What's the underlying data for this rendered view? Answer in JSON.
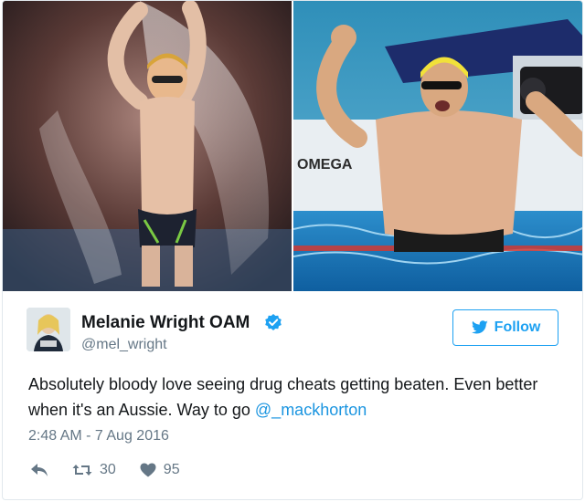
{
  "images": {
    "left": {
      "description_icon": "swimmer-underwater-photo"
    },
    "right": {
      "description_icon": "swimmer-celebrating-photo",
      "signage": "OMEGA"
    }
  },
  "user": {
    "name": "Melanie Wright OAM",
    "handle": "@mel_wright",
    "verified_icon": "verified-badge-icon",
    "avatar_icon": "avatar"
  },
  "follow_button": {
    "label": "Follow",
    "icon": "twitter-bird-icon"
  },
  "tweet": {
    "text": "Absolutely bloody love seeing drug cheats getting beaten. Even better when it's an Aussie. Way to go ",
    "mention": "@_mackhorton",
    "timestamp": "2:48 AM - 7 Aug 2016"
  },
  "actions": {
    "reply_icon": "reply-icon",
    "retweet_icon": "retweet-icon",
    "retweets": "30",
    "like_icon": "heart-icon",
    "likes": "95"
  },
  "colors": {
    "accent": "#1da1f2",
    "mention": "#1b95e0",
    "secondary_text": "#657786",
    "border": "#e1e8ed"
  }
}
